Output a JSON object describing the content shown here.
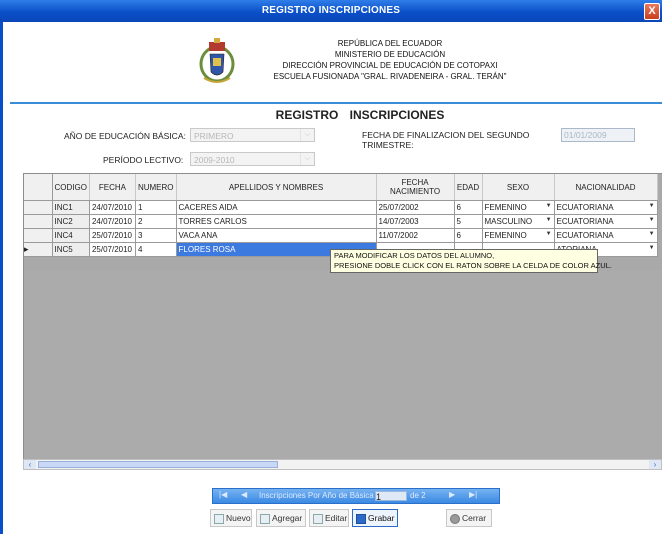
{
  "window": {
    "title": "REGISTRO INSCRIPCIONES",
    "close_glyph": "X"
  },
  "header": {
    "lines": [
      "REPÚBLICA DEL ECUADOR",
      "MINISTERIO DE EDUCACIÓN",
      "DIRECCIÓN PROVINCIAL DE EDUCACIÓN DE COTOPAXI",
      "ESCUELA FUSIONADA \"GRAL. RIVADENEIRA - GRAL. TERÁN\""
    ]
  },
  "form": {
    "title": "REGISTRO INSCRIPCIONES",
    "anio_label": "AÑO DE EDUCACIÓN BÁSICA:",
    "anio_value": "PRIMERO",
    "periodo_label": "PERÍODO LECTIVO:",
    "periodo_value": "2009-2010",
    "fecha_label_1": "FECHA DE FINALIZACION DEL SEGUNDO",
    "fecha_label_2": "TRIMESTRE:",
    "fecha_value": "01/01/2009"
  },
  "grid": {
    "columns": [
      "CODIGO",
      "FECHA",
      "NUMERO",
      "APELLIDOS Y NOMBRES",
      "FECHA NACIMIENTO",
      "EDAD",
      "SEXO",
      "NACIONALIDAD"
    ],
    "rows": [
      {
        "codigo": "INC1",
        "fecha": "24/07/2010",
        "numero": "1",
        "nombre": "CACERES AIDA",
        "nacimiento": "25/07/2002",
        "edad": "6",
        "sexo": "FEMENINO",
        "nacionalidad": "ECUATORIANA"
      },
      {
        "codigo": "INC2",
        "fecha": "24/07/2010",
        "numero": "2",
        "nombre": "TORRES CARLOS",
        "nacimiento": "14/07/2003",
        "edad": "5",
        "sexo": "MASCULINO",
        "nacionalidad": "ECUATORIANA"
      },
      {
        "codigo": "INC4",
        "fecha": "25/07/2010",
        "numero": "3",
        "nombre": "VACA ANA",
        "nacimiento": "11/07/2002",
        "edad": "6",
        "sexo": "FEMENINO",
        "nacionalidad": "ECUATORIANA"
      },
      {
        "codigo": "INC5",
        "fecha": "25/07/2010",
        "numero": "4",
        "nombre": "FLORES ROSA",
        "nacimiento": "",
        "edad": "",
        "sexo": "",
        "nacionalidad": "ATORIANA"
      }
    ],
    "current_row_marker": "▸",
    "tooltip_1": "PARA MODIFICAR LOS DATOS DEL ALUMNO,",
    "tooltip_2": "PRESIONE DOBLE CLICK CON EL RATON SOBRE LA CELDA DE COLOR AZUL."
  },
  "navigator": {
    "first": "|◀",
    "prev": "◀",
    "label": "Inscripciones Por Año de Básica",
    "position": "1",
    "of": "de 2",
    "next": "▶",
    "last": "▶|"
  },
  "toolbar": {
    "nuevo": "Nuevo",
    "agregar": "Agregar",
    "editar": "Editar",
    "grabar": "Grabar",
    "cerrar": "Cerrar"
  },
  "colors": {
    "titlebar": "#0a4fc9",
    "selected_cell": "#3c7ae0",
    "rule": "#3a8bd8",
    "tooltip_bg": "#ffffe1"
  },
  "icons": [
    "crest-logo",
    "close-icon",
    "new-doc-icon",
    "add-icon",
    "edit-icon",
    "save-icon",
    "close-circle-icon"
  ]
}
